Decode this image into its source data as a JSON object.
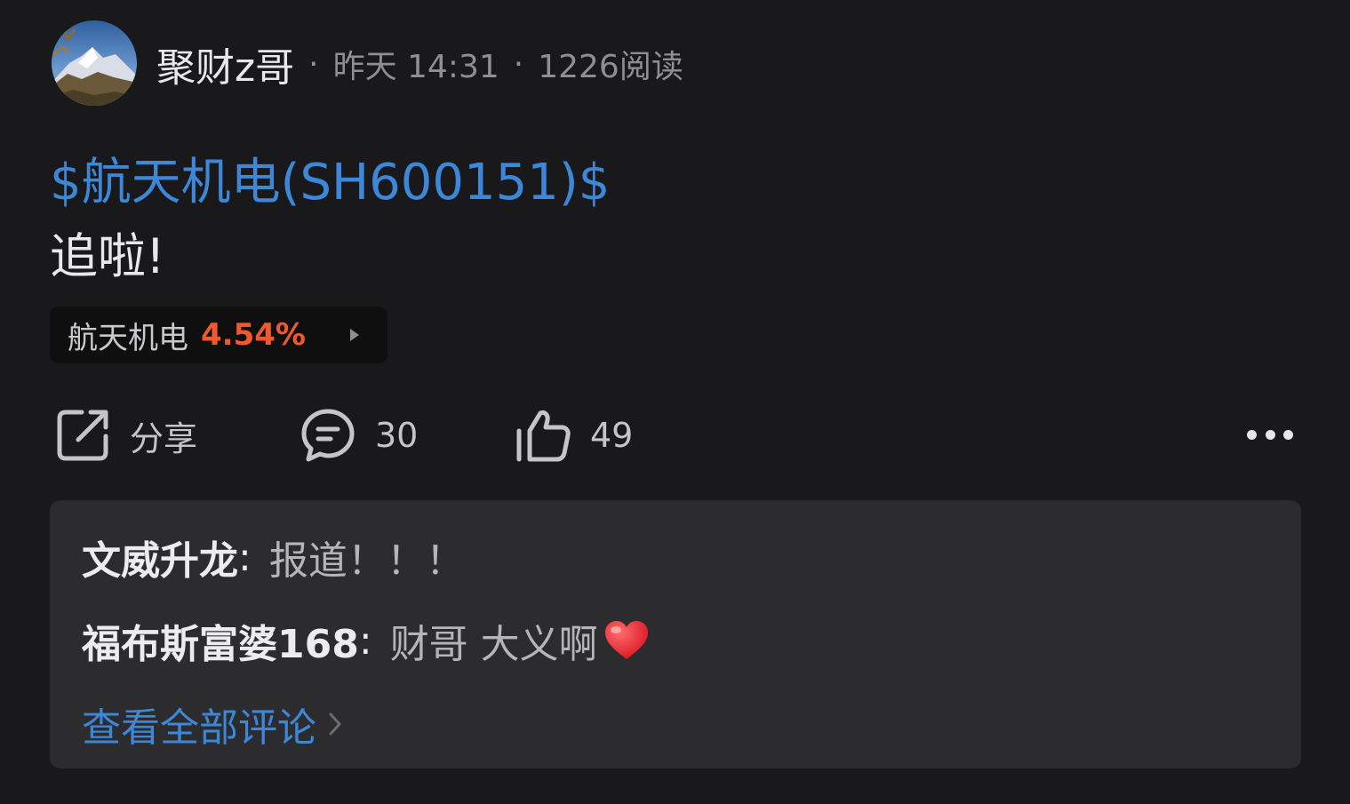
{
  "post": {
    "author": "聚财z哥",
    "time": "昨天 14:31",
    "reads": "1226阅读",
    "separator": "·",
    "stock_link": "$航天机电(SH600151)$",
    "text": "追啦!"
  },
  "stock_chip": {
    "name": "航天机电",
    "change": "4.54%",
    "color": "#f2582c"
  },
  "actions": {
    "share_label": "分享",
    "comment_count": "30",
    "like_count": "49"
  },
  "comments": [
    {
      "user": "文威升龙",
      "colon": ":",
      "text": "报道！！！"
    },
    {
      "user": "福布斯富婆168",
      "colon": ":",
      "text": "财哥 大义啊"
    }
  ],
  "view_all_label": "查看全部评论",
  "colors": {
    "background": "#19191b",
    "link_blue": "#3d87d9",
    "comment_panel": "#2c2c2e"
  }
}
